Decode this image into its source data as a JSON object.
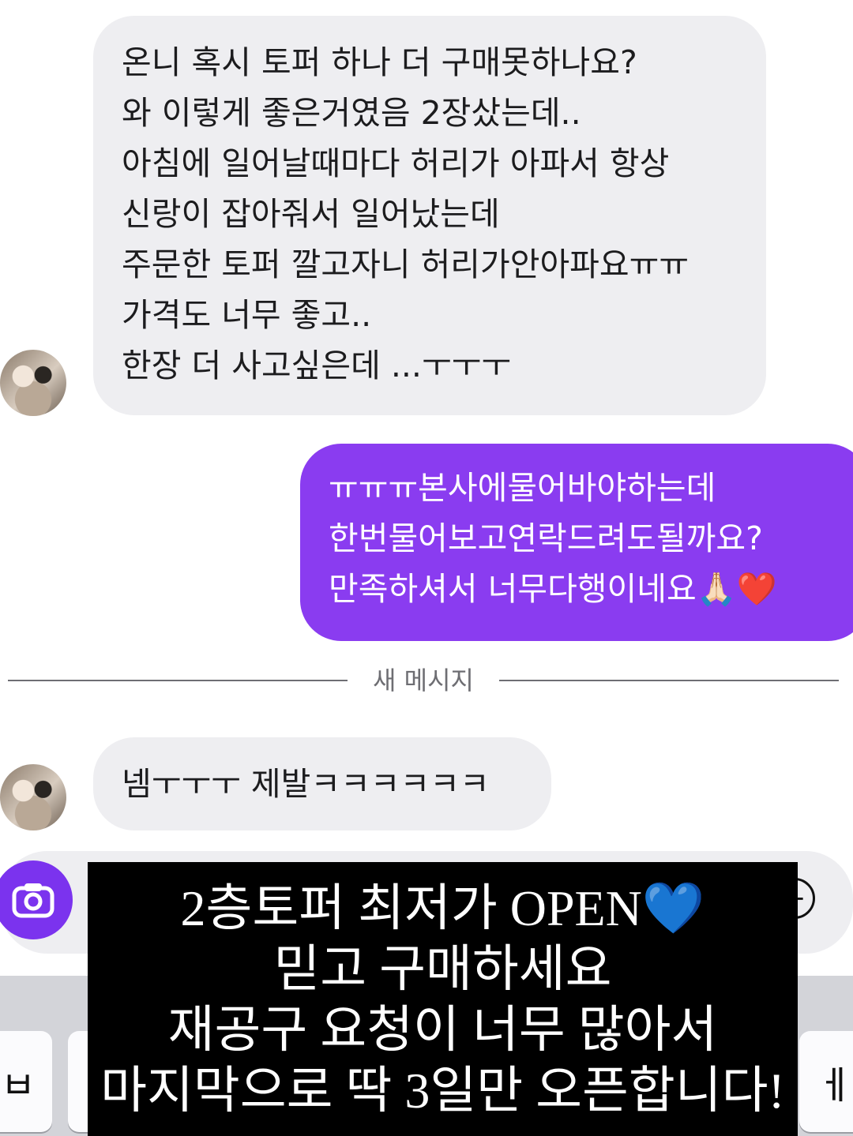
{
  "incoming_message_1": {
    "lines": [
      "온니 혹시 토퍼 하나 더 구매못하나요?",
      "와 이렇게 좋은거였음 2장샀는데..",
      "아침에 일어날때마다 허리가 아파서 항상",
      "신랑이 잡아줘서 일어났는데",
      "주문한 토퍼 깔고자니 허리가안아파요ㅠㅠ",
      "가격도 너무 좋고..",
      "한장 더 사고싶은데 ...ㅜㅜㅜ"
    ]
  },
  "outgoing_message": {
    "lines": [
      "ㅠㅠㅠ본사에물어바야하는데",
      "한번물어보고연락드려도될까요?",
      "만족하셔서 너무다행이네요🙏🏻❤️"
    ]
  },
  "divider": {
    "label": "새 메시지"
  },
  "incoming_message_2": {
    "text": "넴ㅜㅜㅜ 제발ㅋㅋㅋㅋㅋㅋ"
  },
  "keyboard": {
    "left_key": "ㅂ",
    "right_key": "ㅔ"
  },
  "overlay": {
    "lines": [
      "2층토퍼 최저가 OPEN💙",
      "믿고 구매하세요",
      "재공구 요청이 너무 많아서",
      "마지막으로 딱 3일만 오픈합니다!"
    ]
  },
  "colors": {
    "incoming_bubble": "#eeeef1",
    "outgoing_bubble": "#8a3cf0",
    "camera_button": "#7b33ee",
    "overlay_bg": "#000000"
  },
  "icons": [
    "avatar",
    "camera-icon",
    "add-icon"
  ]
}
